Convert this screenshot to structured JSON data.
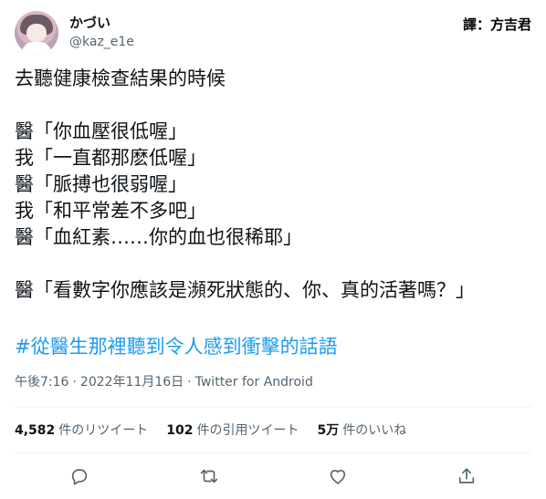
{
  "author": {
    "display_name": "かづい",
    "handle": "@kaz_e1e"
  },
  "translator_credit": "譯：方吉君",
  "tweet": {
    "lines": [
      "去聽健康檢查結果的時候",
      "",
      "醫「你血壓很低喔」",
      "我「一直都那麽低喔」",
      "醫「脈搏也很弱喔」",
      "我「和平常差不多吧」",
      "醫「血紅素……你的血也很稀耶」",
      "",
      "醫「看數字你應該是瀕死狀態的、你、真的活著嗎？」"
    ],
    "hashtag": "#從醫生那裡聽到令人感到衝擊的話語"
  },
  "meta": {
    "time": "午後7:16",
    "date": "2022年11月16日",
    "separator": "·",
    "client": "Twitter for Android"
  },
  "stats": {
    "retweets_count": "4,582",
    "retweets_label": "件のリツイート",
    "quotes_count": "102",
    "quotes_label": "件の引用ツイート",
    "likes_count": "5万",
    "likes_label": "件のいいね"
  },
  "actions": {
    "reply": "reply-icon",
    "retweet": "retweet-icon",
    "like": "heart-icon",
    "share": "share-icon"
  },
  "colors": {
    "text": "#0f1419",
    "secondary": "#536471",
    "link": "#1d9bf0",
    "divider": "#eff3f4"
  }
}
